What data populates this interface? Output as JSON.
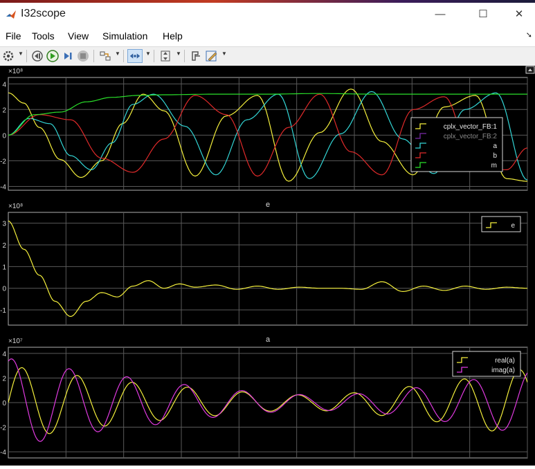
{
  "window": {
    "title": "I32scope",
    "minimize_label": "—",
    "maximize_label": "☐",
    "close_label": "✕"
  },
  "menu": {
    "items": [
      "File",
      "Tools",
      "View",
      "Simulation",
      "Help"
    ],
    "pin_label": "➘"
  },
  "toolbar": {
    "buttons": [
      "settings-icon",
      "step-back-icon",
      "run-icon",
      "step-forward-icon",
      "stop-icon",
      "highlight-icon",
      "zoom-x-icon",
      "zoom-y-icon",
      "cursor-icon",
      "edit-icon"
    ]
  },
  "colors": {
    "plot_bg": "#000000",
    "axes": "#b0b0b0",
    "grid": "#5a5a5a",
    "yellow": "#f5f03c",
    "purple": "#7a2aa8",
    "cyan": "#33d6d6",
    "red": "#e02a2a",
    "green": "#2ae02a",
    "magenta": "#e03ae0"
  },
  "chart_data": [
    {
      "type": "line",
      "title": "",
      "exponent": "×10⁸",
      "xlim": [
        0,
        10
      ],
      "ylim": [
        -4.3,
        4.5
      ],
      "yticks": [
        4,
        2,
        0,
        -2,
        -4
      ],
      "grid": true,
      "legend_position": "right",
      "series": [
        {
          "name": "cplx_vector_FB:1",
          "color": "#f5f03c",
          "x": [
            0,
            0.3,
            0.6,
            1.0,
            1.4,
            1.8,
            2.2,
            2.6,
            3.0,
            3.6,
            4.2,
            4.8,
            5.4,
            6.0,
            6.6,
            7.2,
            7.8,
            8.4,
            9.0,
            9.6,
            10.0
          ],
          "y": [
            3.3,
            2.5,
            0.6,
            -1.9,
            -3.3,
            -2.0,
            0.9,
            3.2,
            1.9,
            -3.2,
            1.5,
            3.1,
            -3.6,
            0.2,
            3.6,
            -0.5,
            -3.1,
            2.2,
            3.1,
            -3.4,
            -3.6
          ]
        },
        {
          "name": "cplx_vector_FB:2",
          "color": "#7a2aa8",
          "x": [],
          "y": []
        },
        {
          "name": "a",
          "color": "#33d6d6",
          "x": [
            0,
            0.4,
            0.8,
            1.2,
            1.6,
            2.0,
            2.4,
            2.8,
            3.4,
            4.0,
            4.6,
            5.2,
            5.8,
            6.4,
            7.0,
            7.6,
            8.2,
            8.8,
            9.4,
            10.0
          ],
          "y": [
            0.0,
            1.3,
            0.9,
            -1.6,
            -2.7,
            -0.6,
            2.4,
            3.2,
            0.7,
            -3.1,
            1.2,
            3.2,
            -3.4,
            0.1,
            3.4,
            -0.3,
            -3.0,
            2.0,
            3.3,
            -3.5
          ]
        },
        {
          "name": "b",
          "color": "#e02a2a",
          "x": [
            0,
            0.6,
            1.2,
            1.8,
            2.4,
            3.0,
            3.6,
            4.2,
            4.8,
            5.4,
            6.0,
            6.6,
            7.2,
            7.8,
            8.4,
            9.0,
            9.6,
            10.0
          ],
          "y": [
            0.0,
            1.6,
            1.2,
            -1.8,
            -2.9,
            -0.3,
            3.1,
            1.6,
            -3.2,
            0.6,
            3.2,
            -1.3,
            -3.1,
            2.0,
            3.0,
            -2.6,
            -2.7,
            -1.0
          ]
        },
        {
          "name": "m",
          "color": "#2ae02a",
          "x": [
            0,
            0.5,
            1.0,
            1.5,
            2.0,
            2.5,
            3.0,
            4.0,
            5.0,
            6.0,
            7.0,
            8.0,
            9.0,
            10.0
          ],
          "y": [
            0.0,
            1.6,
            1.8,
            2.6,
            2.95,
            3.1,
            3.15,
            3.2,
            3.2,
            3.25,
            3.2,
            3.2,
            3.2,
            3.2
          ]
        }
      ]
    },
    {
      "type": "line",
      "title": "e",
      "exponent": "×10⁸",
      "xlim": [
        0,
        10
      ],
      "ylim": [
        -1.7,
        3.5
      ],
      "yticks": [
        3,
        2,
        1,
        0,
        -1
      ],
      "grid": true,
      "legend_position": "top-right",
      "series": [
        {
          "name": "e",
          "color": "#f5f03c",
          "x": [
            0,
            0.3,
            0.6,
            0.9,
            1.2,
            1.5,
            1.8,
            2.1,
            2.4,
            2.7,
            3.0,
            3.3,
            3.6,
            4.0,
            4.4,
            4.8,
            5.2,
            5.6,
            6.0,
            6.4,
            6.8,
            7.2,
            7.6,
            8.0,
            8.4,
            8.8,
            9.2,
            9.6,
            10.0
          ],
          "y": [
            3.1,
            1.8,
            0.6,
            -0.6,
            -1.3,
            -0.6,
            -0.2,
            -0.4,
            0.1,
            0.35,
            0.0,
            0.2,
            0.05,
            0.15,
            -0.05,
            0.1,
            -0.05,
            0.05,
            0.0,
            0.0,
            -0.05,
            0.3,
            -0.15,
            0.1,
            -0.1,
            0.1,
            -0.05,
            0.05,
            0.0
          ]
        }
      ]
    },
    {
      "type": "line",
      "title": "a",
      "exponent": "×10⁷",
      "xlim": [
        0,
        10
      ],
      "ylim": [
        -4.5,
        4.5
      ],
      "yticks": [
        4,
        2,
        0,
        -2,
        -4
      ],
      "grid": true,
      "legend_position": "top-right",
      "series": [
        {
          "name": "real(a)",
          "color": "#f5f03c",
          "amplitude_env": [
            3.0,
            2.5,
            2.0,
            1.6,
            1.3,
            1.0,
            0.7,
            0.6,
            0.8,
            1.2,
            1.6,
            2.2,
            2.8
          ],
          "frequency": 9.4,
          "phase": 0
        },
        {
          "name": "imag(a)",
          "color": "#e03ae0",
          "amplitude_env": [
            3.6,
            3.0,
            2.4,
            2.0,
            1.5,
            1.1,
            0.8,
            0.6,
            0.7,
            1.0,
            1.5,
            2.0,
            2.6
          ],
          "frequency": 9.0,
          "phase": 1.2
        }
      ]
    }
  ]
}
